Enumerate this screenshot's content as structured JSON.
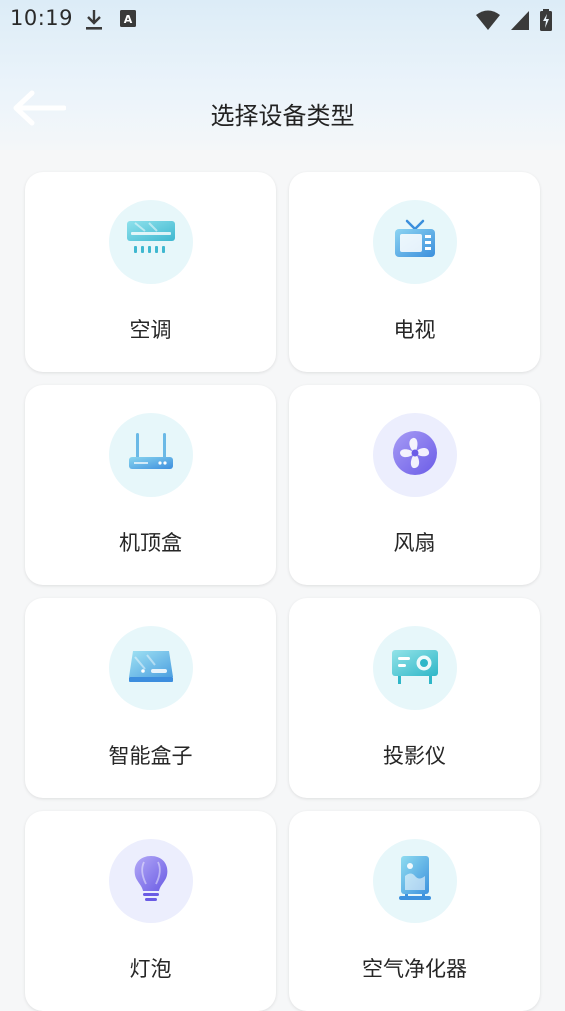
{
  "status_bar": {
    "time": "10:19",
    "icons": [
      "download-icon",
      "a-notification-icon",
      "wifi-icon",
      "signal-icon",
      "battery-icon"
    ]
  },
  "header": {
    "title": "选择设备类型",
    "back_icon": "back-arrow-icon"
  },
  "devices": [
    {
      "label": "空调",
      "icon": "air-conditioner-icon",
      "bg": "#e7f7fa"
    },
    {
      "label": "电视",
      "icon": "tv-icon",
      "bg": "#e7f7fa"
    },
    {
      "label": "机顶盒",
      "icon": "set-top-box-icon",
      "bg": "#e7f7fa"
    },
    {
      "label": "风扇",
      "icon": "fan-icon",
      "bg": "#eceefd"
    },
    {
      "label": "智能盒子",
      "icon": "smart-box-icon",
      "bg": "#e7f7fa"
    },
    {
      "label": "投影仪",
      "icon": "projector-icon",
      "bg": "#e7f7fa"
    },
    {
      "label": "灯泡",
      "icon": "light-bulb-icon",
      "bg": "#eceefd"
    },
    {
      "label": "空气净化器",
      "icon": "air-purifier-icon",
      "bg": "#e7f7fa"
    }
  ]
}
